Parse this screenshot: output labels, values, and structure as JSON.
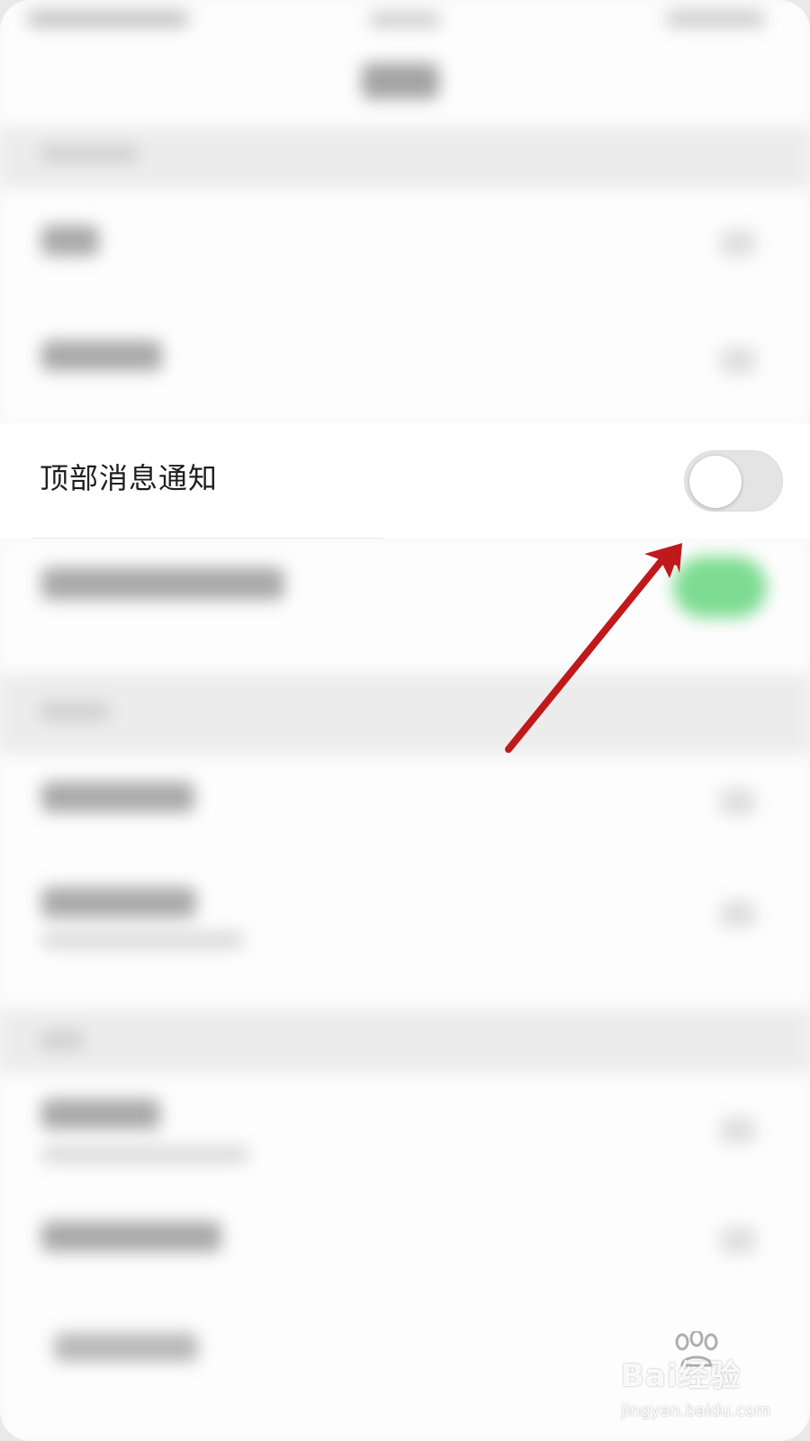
{
  "settings": {
    "top_notification": {
      "label": "顶部消息通知",
      "enabled": false
    }
  },
  "colors": {
    "arrow": "#c0191c",
    "toggle_off_track": "#e4e4e4",
    "blurred_green_toggle": "#7ddc92"
  },
  "watermark": {
    "brand": "Bai经验",
    "site": "jingyan.baidu.com",
    "icon": "paw-icon"
  }
}
